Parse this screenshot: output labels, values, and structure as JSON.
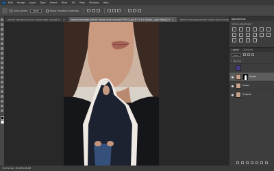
{
  "app": {
    "logo": "Ps"
  },
  "menu": [
    "Edit",
    "Image",
    "Layer",
    "Type",
    "Select",
    "Filter",
    "3D",
    "View",
    "Window",
    "Help"
  ],
  "options": {
    "auto_select_label": "Auto-Select:",
    "auto_select_value": "Layer",
    "transform_label": "Show Transform Controls"
  },
  "tabs": [
    {
      "label": "woman-teenager-portrait-hipster-style-concept-P...",
      "active": false
    },
    {
      "label": "woman-teenager-portrait-hipster-style-concept-P7B5GS.jpg @ 15.4% (Model, Layer Mask/8) *",
      "active": true
    },
    {
      "label": "woman-teenager-portrait-hipster-style-concept",
      "active": false
    }
  ],
  "status": {
    "text": "15.4%    Doc: 30.1M/128.4M"
  },
  "panels": {
    "adjustments_tab": "Adjustments",
    "adjustments_sub": "Add an adjustment",
    "layers_tab": "Layers",
    "channels_tab": "Channels",
    "kind_label": "Kind",
    "blend_mode": "Normal",
    "layers": [
      {
        "name": "",
        "visible": false,
        "selected": false,
        "thumb": "purple-icon"
      },
      {
        "name": "Model",
        "visible": true,
        "selected": true,
        "thumb": "mask-icon"
      },
      {
        "name": "Model",
        "visible": true,
        "selected": false,
        "thumb": "photo-icon"
      },
      {
        "name": "Original",
        "visible": true,
        "selected": false,
        "thumb": "photo-icon"
      }
    ]
  }
}
